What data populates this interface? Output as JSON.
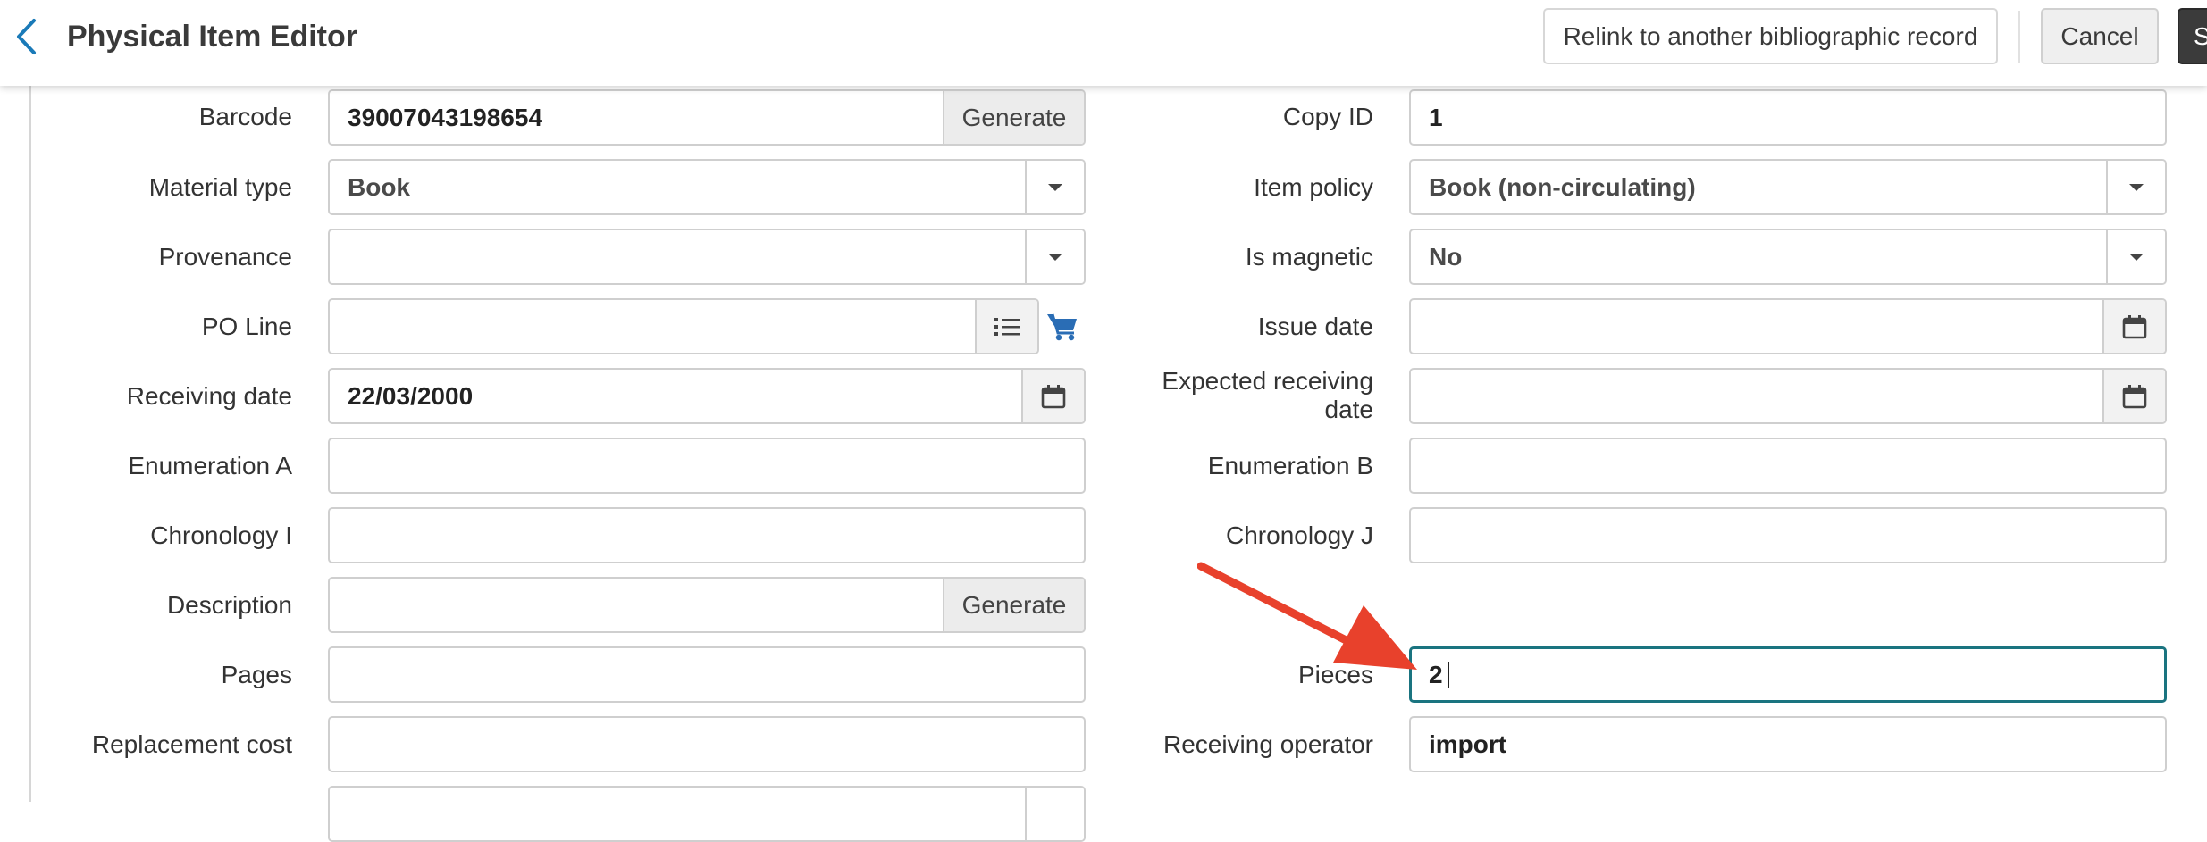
{
  "header": {
    "title": "Physical Item Editor",
    "relink_label": "Relink to another bibliographic record",
    "cancel_label": "Cancel",
    "save_label": "S"
  },
  "left": {
    "barcode": {
      "label": "Barcode",
      "value": "39007043198654",
      "button": "Generate"
    },
    "material_type": {
      "label": "Material type",
      "value": "Book"
    },
    "provenance": {
      "label": "Provenance",
      "value": ""
    },
    "po_line": {
      "label": "PO Line",
      "value": ""
    },
    "receiving_date": {
      "label": "Receiving date",
      "value": "22/03/2000"
    },
    "enumeration_a": {
      "label": "Enumeration A",
      "value": ""
    },
    "chronology_i": {
      "label": "Chronology I",
      "value": ""
    },
    "description": {
      "label": "Description",
      "value": "",
      "button": "Generate"
    },
    "pages": {
      "label": "Pages",
      "value": ""
    },
    "replacement_cost": {
      "label": "Replacement cost",
      "value": ""
    }
  },
  "right": {
    "copy_id": {
      "label": "Copy ID",
      "value": "1"
    },
    "item_policy": {
      "label": "Item policy",
      "value": "Book (non-circulating)"
    },
    "is_magnetic": {
      "label": "Is magnetic",
      "value": "No"
    },
    "issue_date": {
      "label": "Issue date",
      "value": ""
    },
    "expected_receiving_date": {
      "label_line1": "Expected receiving",
      "label_line2": "date",
      "value": ""
    },
    "enumeration_b": {
      "label": "Enumeration B",
      "value": ""
    },
    "chronology_j": {
      "label": "Chronology J",
      "value": ""
    },
    "pieces": {
      "label": "Pieces",
      "value": "2"
    },
    "receiving_operator": {
      "label": "Receiving operator",
      "value": "import"
    }
  },
  "icons": {
    "back": "chevron-left-icon",
    "dropdown": "caret-down-icon",
    "list": "list-icon",
    "cart": "shopping-cart-icon",
    "clear": "clear-x-icon",
    "calendar": "calendar-icon",
    "annotation": "red-arrow-annotation"
  },
  "colors": {
    "accent": "#1a7ab8",
    "focus_border": "#1a7480",
    "cart": "#2a6db5",
    "annotation_arrow": "#e8412c",
    "save_button": "#3b3b3b"
  }
}
